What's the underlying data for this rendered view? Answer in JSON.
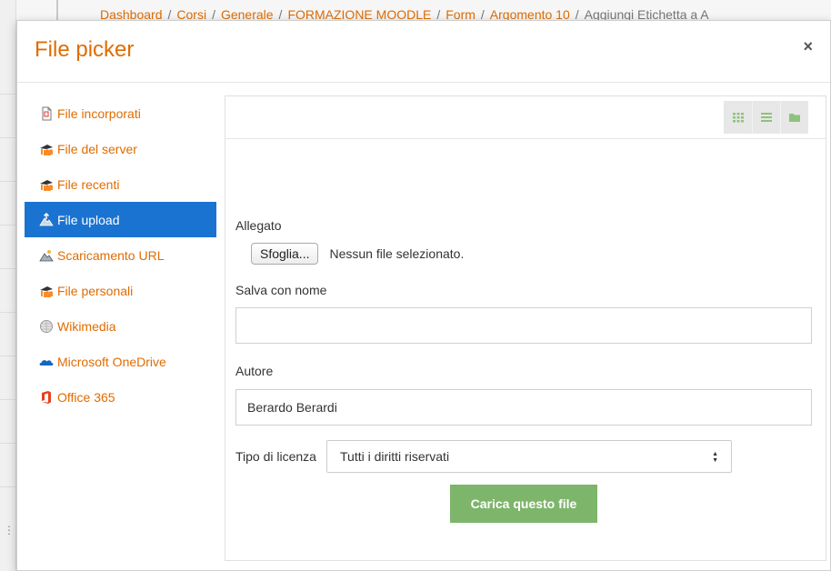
{
  "background": {
    "breadcrumb": [
      "Dashboard",
      "Corsi",
      "Generale",
      "FORMAZIONE MOODLE",
      "Form",
      "Argomento 10"
    ],
    "breadcrumb_last": "Aggiungi Etichetta a A"
  },
  "dialog": {
    "title": "File picker",
    "close_label": "×"
  },
  "sidebar": {
    "items": [
      {
        "label": "File incorporati",
        "icon": "file-icon"
      },
      {
        "label": "File del server",
        "icon": "moodle-icon"
      },
      {
        "label": "File recenti",
        "icon": "moodle-icon"
      },
      {
        "label": "File upload",
        "icon": "upload-icon",
        "active": true
      },
      {
        "label": "Scaricamento URL",
        "icon": "url-download-icon"
      },
      {
        "label": "File personali",
        "icon": "moodle-icon"
      },
      {
        "label": "Wikimedia",
        "icon": "wikimedia-icon"
      },
      {
        "label": "Microsoft OneDrive",
        "icon": "onedrive-icon"
      },
      {
        "label": "Office 365",
        "icon": "office365-icon"
      }
    ]
  },
  "form": {
    "attachment_label": "Allegato",
    "browse_label": "Sfoglia...",
    "file_status": "Nessun file selezionato.",
    "save_as_label": "Salva con nome",
    "save_as_value": "",
    "author_label": "Autore",
    "author_value": "Berardo Berardi",
    "license_label": "Tipo di licenza",
    "license_value": "Tutti i diritti riservati",
    "submit_label": "Carica questo file"
  },
  "colors": {
    "accent": "#e06c00",
    "active": "#1a73d0",
    "submit": "#7db56a",
    "view_icon": "#8fc27d"
  }
}
